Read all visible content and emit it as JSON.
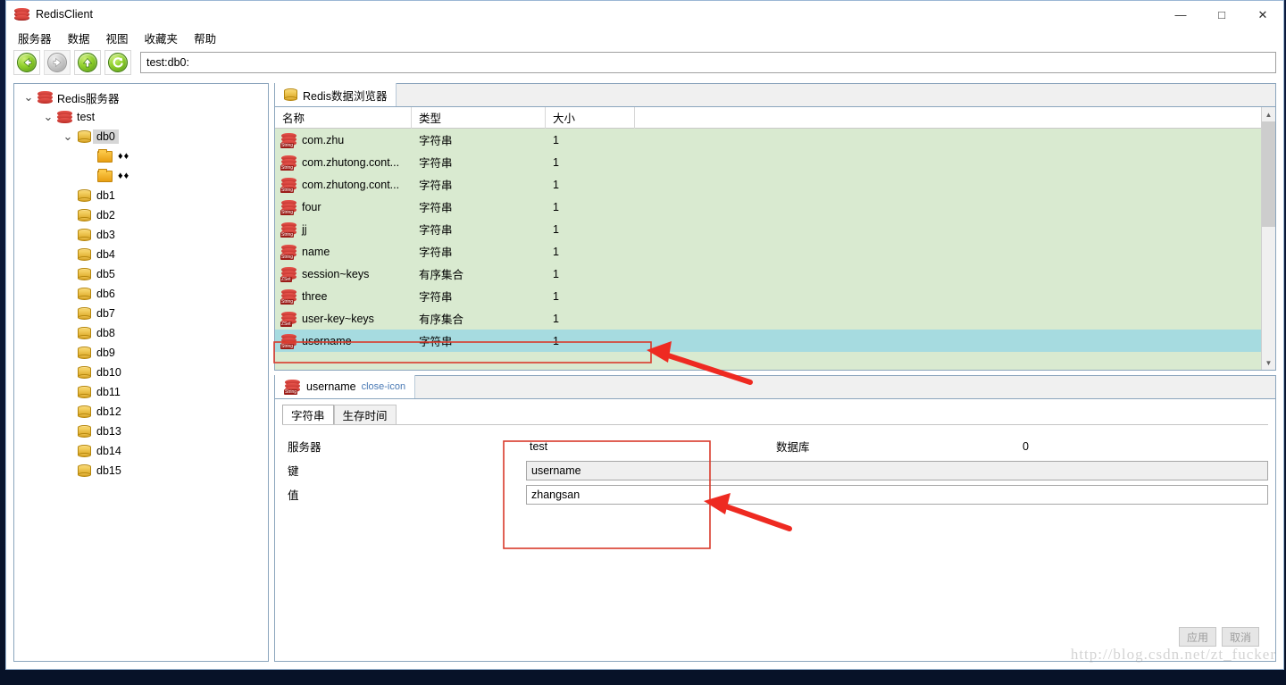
{
  "window": {
    "title": "RedisClient",
    "logo_icon": "redis-logo-icon",
    "minimize_label": "—",
    "maximize_label": "□",
    "close_label": "✕"
  },
  "menubar": {
    "items": [
      {
        "label": "服务器",
        "name": "menu-server"
      },
      {
        "label": "数据",
        "name": "menu-data"
      },
      {
        "label": "视图",
        "name": "menu-view"
      },
      {
        "label": "收藏夹",
        "name": "menu-favorites"
      },
      {
        "label": "帮助",
        "name": "menu-help"
      }
    ]
  },
  "toolbar": {
    "buttons": [
      {
        "name": "back-button",
        "icon": "arrow-left-icon",
        "enabled": true
      },
      {
        "name": "forward-button",
        "icon": "arrow-right-icon",
        "enabled": false
      },
      {
        "name": "up-button",
        "icon": "arrow-up-icon",
        "enabled": true
      },
      {
        "name": "refresh-button",
        "icon": "refresh-icon",
        "enabled": true
      }
    ],
    "address_value": "test:db0:",
    "address_placeholder": ""
  },
  "tree": {
    "nodes": [
      {
        "label": "Redis服务器",
        "icon": "redis-server-icon",
        "indent": 0,
        "twisty": "expanded",
        "selected": false
      },
      {
        "label": "test",
        "icon": "redis-server-icon",
        "indent": 1,
        "twisty": "expanded",
        "selected": false
      },
      {
        "label": "db0",
        "icon": "database-icon",
        "indent": 2,
        "twisty": "expanded",
        "selected": true
      },
      {
        "label": "♦♦",
        "icon": "folder-icon",
        "indent": 3,
        "twisty": "none",
        "selected": false
      },
      {
        "label": "♦♦",
        "icon": "folder-icon",
        "indent": 3,
        "twisty": "none",
        "selected": false
      },
      {
        "label": "db1",
        "icon": "database-icon",
        "indent": 2,
        "twisty": "none",
        "selected": false
      },
      {
        "label": "db2",
        "icon": "database-icon",
        "indent": 2,
        "twisty": "none",
        "selected": false
      },
      {
        "label": "db3",
        "icon": "database-icon",
        "indent": 2,
        "twisty": "none",
        "selected": false
      },
      {
        "label": "db4",
        "icon": "database-icon",
        "indent": 2,
        "twisty": "none",
        "selected": false
      },
      {
        "label": "db5",
        "icon": "database-icon",
        "indent": 2,
        "twisty": "none",
        "selected": false
      },
      {
        "label": "db6",
        "icon": "database-icon",
        "indent": 2,
        "twisty": "none",
        "selected": false
      },
      {
        "label": "db7",
        "icon": "database-icon",
        "indent": 2,
        "twisty": "none",
        "selected": false
      },
      {
        "label": "db8",
        "icon": "database-icon",
        "indent": 2,
        "twisty": "none",
        "selected": false
      },
      {
        "label": "db9",
        "icon": "database-icon",
        "indent": 2,
        "twisty": "none",
        "selected": false
      },
      {
        "label": "db10",
        "icon": "database-icon",
        "indent": 2,
        "twisty": "none",
        "selected": false
      },
      {
        "label": "db11",
        "icon": "database-icon",
        "indent": 2,
        "twisty": "none",
        "selected": false
      },
      {
        "label": "db12",
        "icon": "database-icon",
        "indent": 2,
        "twisty": "none",
        "selected": false
      },
      {
        "label": "db13",
        "icon": "database-icon",
        "indent": 2,
        "twisty": "none",
        "selected": false
      },
      {
        "label": "db14",
        "icon": "database-icon",
        "indent": 2,
        "twisty": "none",
        "selected": false
      },
      {
        "label": "db15",
        "icon": "database-icon",
        "indent": 2,
        "twisty": "none",
        "selected": false
      }
    ]
  },
  "browser": {
    "tab_label": "Redis数据浏览器",
    "tab_icon": "database-icon",
    "columns": [
      "名称",
      "类型",
      "大小",
      ""
    ],
    "rows": [
      {
        "name": "com.zhu",
        "type": "字符串",
        "size": "1",
        "badge": "String",
        "selected": false
      },
      {
        "name": "com.zhutong.cont...",
        "type": "字符串",
        "size": "1",
        "badge": "String",
        "selected": false
      },
      {
        "name": "com.zhutong.cont...",
        "type": "字符串",
        "size": "1",
        "badge": "String",
        "selected": false
      },
      {
        "name": "four",
        "type": "字符串",
        "size": "1",
        "badge": "String",
        "selected": false
      },
      {
        "name": "jj",
        "type": "字符串",
        "size": "1",
        "badge": "String",
        "selected": false
      },
      {
        "name": "name",
        "type": "字符串",
        "size": "1",
        "badge": "String",
        "selected": false
      },
      {
        "name": "session~keys",
        "type": "有序集合",
        "size": "1",
        "badge": "ZSet",
        "selected": false
      },
      {
        "name": "three",
        "type": "字符串",
        "size": "1",
        "badge": "String",
        "selected": false
      },
      {
        "name": "user-key~keys",
        "type": "有序集合",
        "size": "1",
        "badge": "ZSet",
        "selected": false
      },
      {
        "name": "username",
        "type": "字符串",
        "size": "1",
        "badge": "String",
        "selected": true
      }
    ],
    "scroll_up_icon": "chevron-up-icon",
    "scroll_down_icon": "chevron-down-icon"
  },
  "detail": {
    "tab_label": "username",
    "tab_icon": "string-key-icon",
    "tab_close_icon": "close-icon",
    "subtabs": [
      {
        "label": "字符串",
        "active": true
      },
      {
        "label": "生存时间",
        "active": false
      }
    ],
    "fields": {
      "server_label": "服务器",
      "server_value": "test",
      "database_label": "数据库",
      "database_value": "0",
      "key_label": "键",
      "key_value": "username",
      "value_label": "值",
      "value_value": "zhangsan"
    },
    "apply_label": "应用",
    "cancel_label": "取消"
  },
  "watermark": {
    "text": "http://blog.csdn.net/zt_fucker"
  }
}
